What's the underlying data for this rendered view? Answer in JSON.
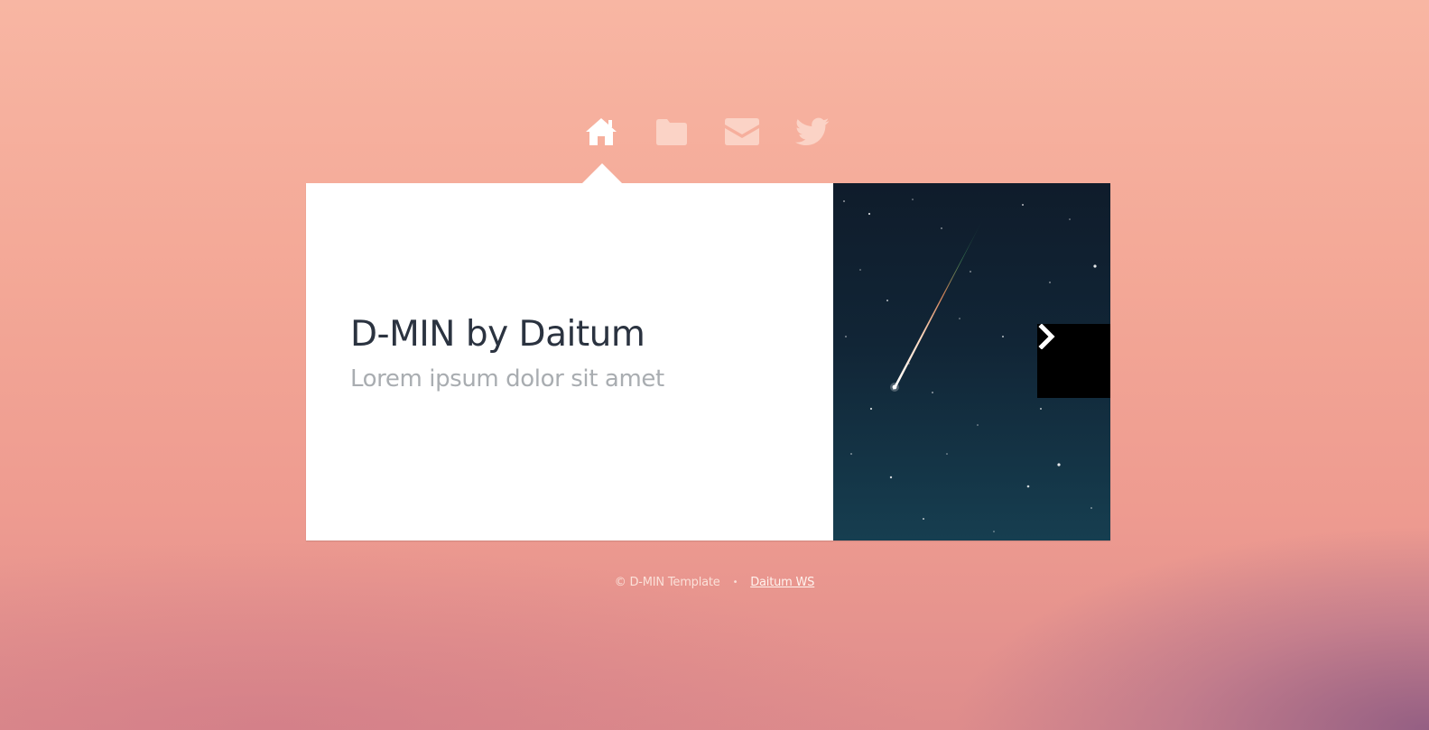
{
  "nav": {
    "items": [
      {
        "icon": "home-icon",
        "active": true
      },
      {
        "icon": "folder-icon",
        "active": false
      },
      {
        "icon": "mail-icon",
        "active": false
      },
      {
        "icon": "twitter-icon",
        "active": false
      }
    ]
  },
  "card": {
    "title": "D-MIN by Daitum",
    "subtitle": "Lorem ipsum dolor sit amet",
    "next_icon": "chevron-right-icon"
  },
  "footer": {
    "copyright": "© D-MIN Template",
    "separator": "•",
    "link_label": "Daitum WS"
  },
  "colors": {
    "card_bg": "#ffffff",
    "title": "#2b3340",
    "subtitle": "#a9adb1",
    "icon_active": "#ffffff",
    "icon_inactive": "#fbd3c6"
  }
}
